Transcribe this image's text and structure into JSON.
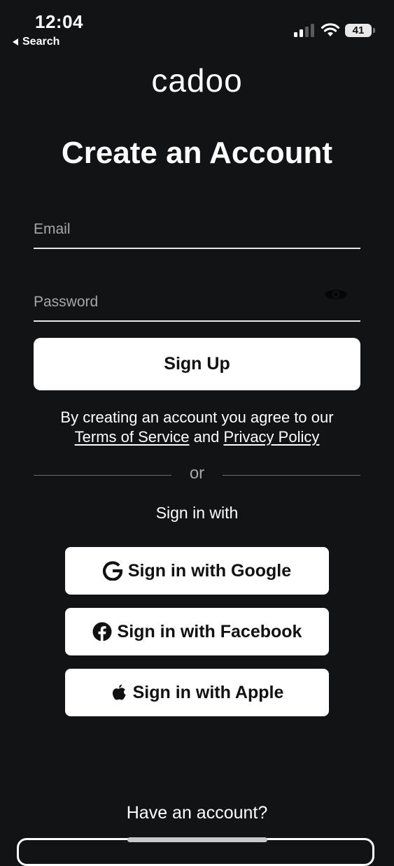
{
  "status_bar": {
    "time": "12:04",
    "back_label": "Search",
    "battery": "41"
  },
  "logo": "cadoo",
  "title": "Create an Account",
  "form": {
    "email_placeholder": "Email",
    "password_placeholder": "Password",
    "signup_label": "Sign Up"
  },
  "agreement": {
    "prefix": "By creating an account you agree to our",
    "terms_label": "Terms of Service",
    "and": "and",
    "privacy_label": "Privacy Policy"
  },
  "divider_text": "or",
  "signin_with_label": "Sign in with",
  "social": {
    "google_label": "Sign in with Google",
    "facebook_label": "Sign in with Facebook",
    "apple_label": "Sign in with Apple"
  },
  "footer": {
    "have_account": "Have an account?"
  },
  "icons": {
    "google": "google-icon",
    "facebook": "facebook-icon",
    "apple": "apple-icon",
    "eye": "eye-icon"
  }
}
